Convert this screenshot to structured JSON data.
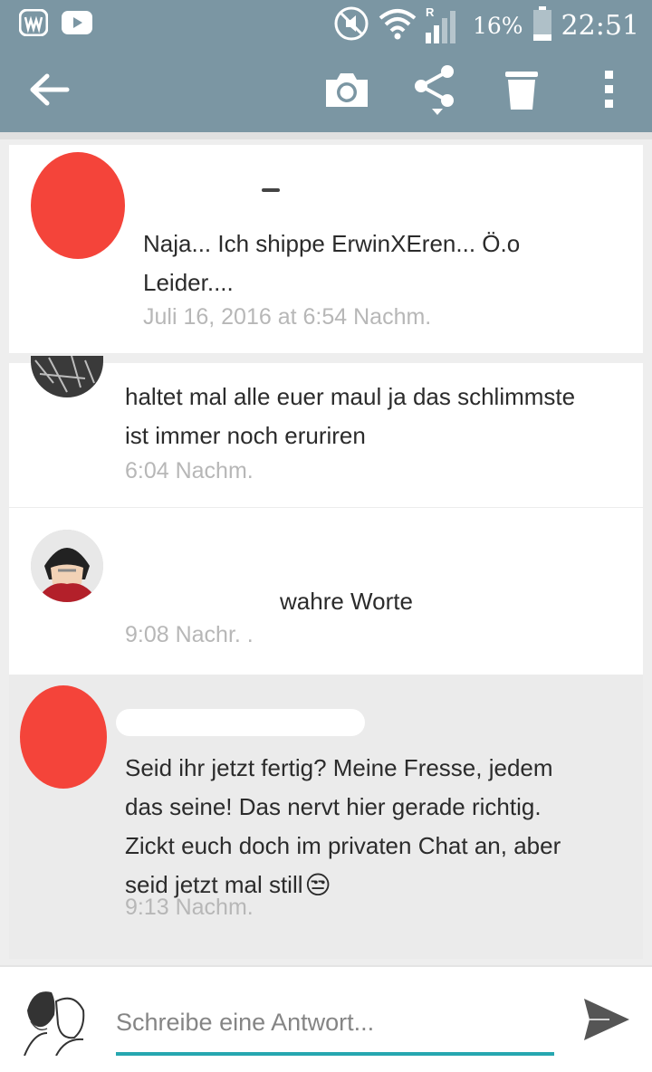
{
  "status_bar": {
    "battery_percent": "16%",
    "time": "22:51",
    "roaming_indicator": "R",
    "icons": [
      "app-w-icon",
      "youtube-icon",
      "mute-icon",
      "wifi-icon",
      "signal-icon",
      "battery-icon"
    ]
  },
  "app_bar": {
    "icons": [
      "back-arrow-icon",
      "camera-icon",
      "share-icon",
      "trash-icon",
      "more-vert-icon"
    ],
    "color": "#7b96a3"
  },
  "messages": [
    {
      "text_line1": "Naja... Ich shippe ErwinXEren... Ö.o",
      "text_line2": "Leider....",
      "timestamp": "Juli 16, 2016 at 6:54 Nachm.",
      "author_redacted": true
    },
    {
      "text_line1": "haltet mal alle euer maul ja das schlimmste",
      "text_line2": "ist immer noch eruriren",
      "timestamp": "6:04 Nachm."
    },
    {
      "text": "wahre Worte",
      "timestamp": "9:08 Nachr. ."
    },
    {
      "text_line1": "Seid ihr jetzt fertig? Meine Fresse, jedem",
      "text_line2": "das seine! Das nervt hier gerade richtig.",
      "text_line3": "Zickt euch doch im privaten Chat an, aber",
      "text_line4": "seid jetzt mal still",
      "emoji": "😒",
      "timestamp": "9:13 Nachm.",
      "highlighted": true,
      "author_redacted": true
    }
  ],
  "composer": {
    "placeholder": "Schreibe eine Antwort...",
    "accent": "#26a7b0",
    "send_icon": "send-icon"
  },
  "colors": {
    "redaction": "#f4443a",
    "timestamp": "#b7b7b7",
    "highlight_bg": "#ebebeb"
  }
}
